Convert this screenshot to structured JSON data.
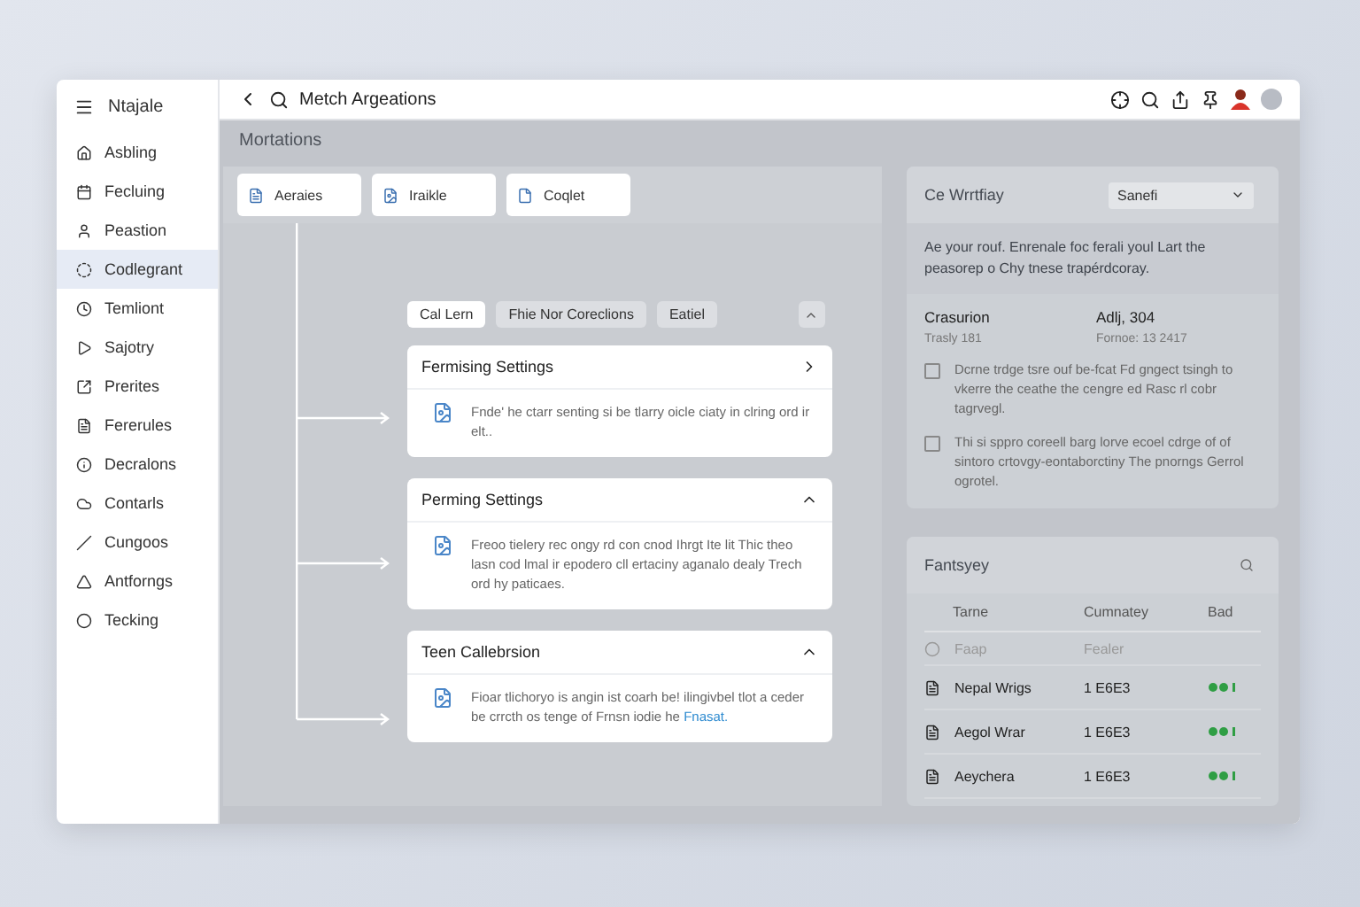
{
  "sidebar": {
    "title": "Ntajale",
    "items": [
      {
        "label": "Asbling",
        "selected": false
      },
      {
        "label": "Fecluing",
        "selected": false
      },
      {
        "label": "Peastion",
        "selected": false
      },
      {
        "label": "Codlegrant",
        "selected": true
      },
      {
        "label": "Temliont",
        "selected": false
      },
      {
        "label": "Sajotry",
        "selected": false
      },
      {
        "label": "Prerites",
        "selected": false
      },
      {
        "label": "Fererules",
        "selected": false
      },
      {
        "label": "Decralons",
        "selected": false
      },
      {
        "label": "Contarls",
        "selected": false
      },
      {
        "label": "Cungoos",
        "selected": false
      },
      {
        "label": "Antforngs",
        "selected": false
      },
      {
        "label": "Tecking",
        "selected": false
      }
    ]
  },
  "topbar": {
    "title": "Metch Argeations"
  },
  "heading": "Mortations",
  "tabs": [
    {
      "label": "Aeraies"
    },
    {
      "label": "Iraikle"
    },
    {
      "label": "Coqlet"
    }
  ],
  "filters": [
    {
      "label": "Cal Lern",
      "selected": true
    },
    {
      "label": "Fhie Nor Coreclions",
      "selected": false
    },
    {
      "label": "Eatiel",
      "selected": false
    }
  ],
  "cards": [
    {
      "title": "Fermising Settings",
      "expanded": false,
      "body": "Fnde' he ctarr senting si be tlarry oicle ciaty in clring ord ir elt.."
    },
    {
      "title": "Perming Settings",
      "expanded": true,
      "body": "Freoo tielery rec ongy rd con cnod Ihrgt Ite lit Thic theo lasn cod lmal ir epodero cll ertaciny aganalo dealy Trech ord hy paticaes."
    },
    {
      "title": "Teen Callebrsion",
      "expanded": true,
      "body": "Fioar tlichoryo is angin ist coarh be! ilingivbel tlot a ceder be crrcth os tenge of Frnsn iodie he",
      "link": "Fnasat."
    }
  ],
  "workday": {
    "title": "Ce Wrrtfiay",
    "select": "Sanefi",
    "description": "Ae your rouf. Enrenale foc ferali youl Lart the peasorep o Chy tnese trapérdcoray.",
    "stats": [
      {
        "label": "Crasurion",
        "sub": "Trasly 181"
      },
      {
        "label": "Adlj, 304",
        "sub": "Fornoe: 13 2417"
      }
    ],
    "checks": [
      {
        "text": "Dcrne trdge tsre ouf be-fcat Fd gngect tsingh to vkerre the ceathe the cengre ed Rasc rl cobr tagrvegl.",
        "checked": false
      },
      {
        "text": "Thi si sppro coreell barg lorve ecoel cdrge of of sintoro crtovgy-eontaborctiny The pnorngs Gerrol ogrotel.",
        "checked": false
      }
    ]
  },
  "table": {
    "title": "Fantsyey",
    "columns": [
      "Tarne",
      "Cumnatey",
      "Bad"
    ],
    "rows": [
      {
        "kind": "placeholder",
        "name": "Faap",
        "value": "Fealer"
      },
      {
        "kind": "item",
        "name": "Nepal Wrigs",
        "value": "1 E6E3"
      },
      {
        "kind": "item",
        "name": "Aegol Wrar",
        "value": "1 E6E3"
      },
      {
        "kind": "item",
        "name": "Aeychera",
        "value": "1 E6E3"
      }
    ]
  }
}
